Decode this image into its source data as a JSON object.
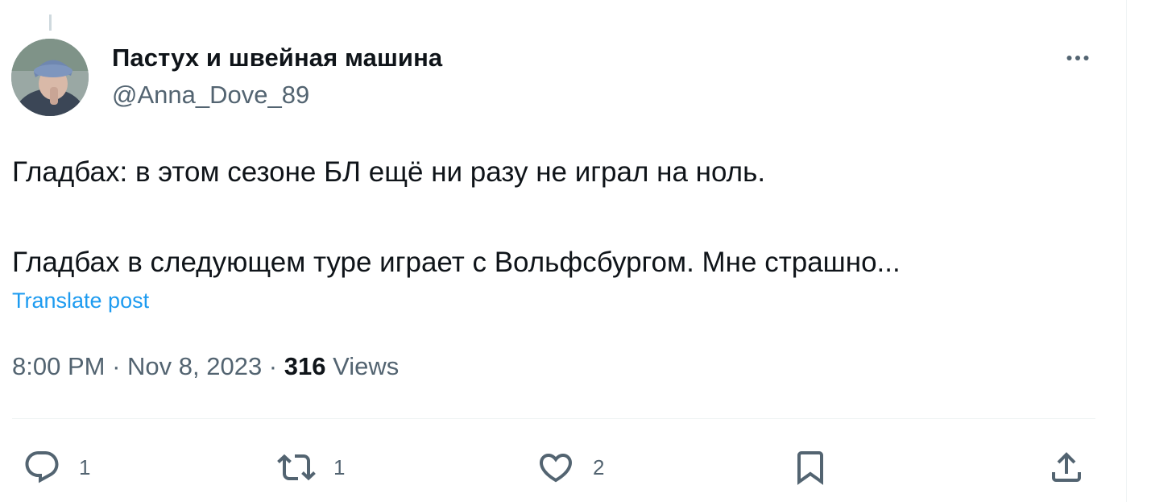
{
  "author": {
    "display_name": "Пастух и швейная машина",
    "handle": "@Anna_Dove_89"
  },
  "tweet": {
    "text": "Гладбах: в этом сезоне БЛ ещё ни разу не играл на ноль.\n\nГладбах в следующем туре играет с Вольфсбургом. Мне страшно...",
    "translate_label": "Translate post"
  },
  "meta": {
    "time": "8:00 PM",
    "date": "Nov 8, 2023",
    "views_count": "316",
    "views_label": "Views"
  },
  "actions": {
    "reply_count": "1",
    "retweet_count": "1",
    "like_count": "2"
  },
  "icons": [
    "more-icon",
    "reply-icon",
    "retweet-icon",
    "like-icon",
    "bookmark-icon",
    "share-icon"
  ],
  "colors": {
    "accent": "#1d9bf0",
    "secondary_text": "#536471",
    "primary_text": "#0f1419",
    "divider": "#eff3f4"
  }
}
